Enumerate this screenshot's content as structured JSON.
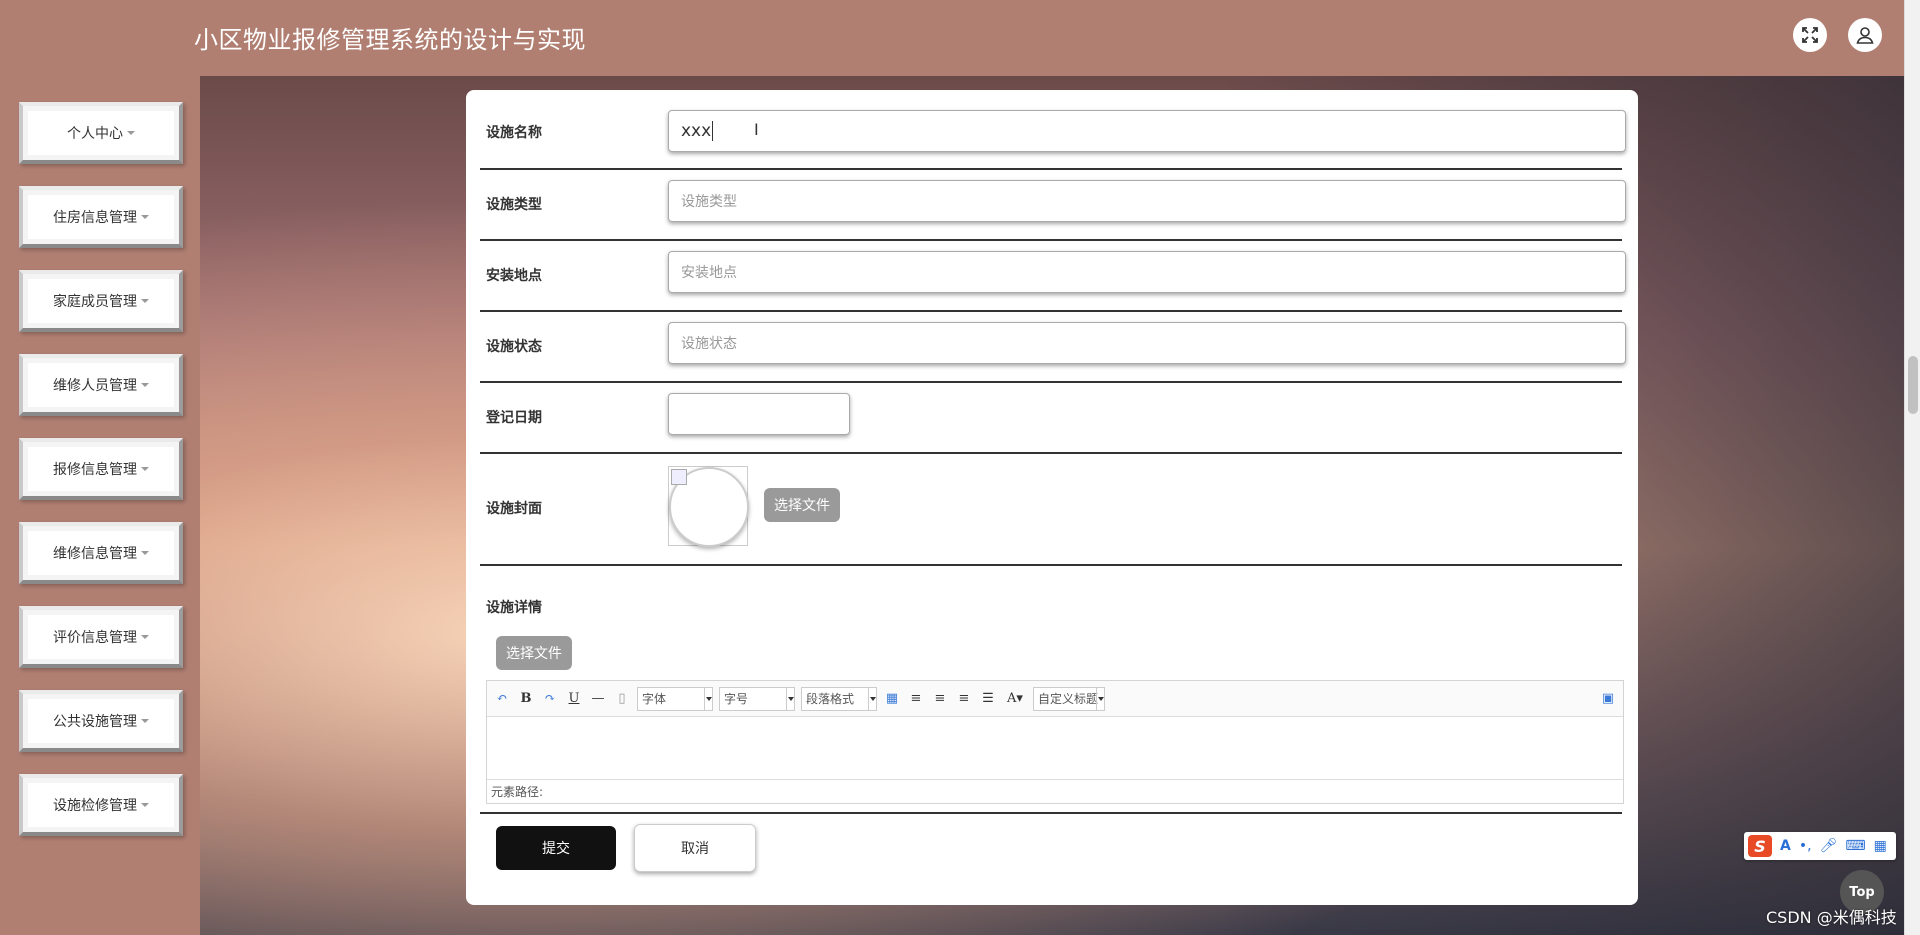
{
  "header": {
    "title": "小区物业报修管理系统的设计与实现"
  },
  "sidebar": {
    "items": [
      {
        "label": "个人中心"
      },
      {
        "label": "住房信息管理"
      },
      {
        "label": "家庭成员管理"
      },
      {
        "label": "维修人员管理"
      },
      {
        "label": "报修信息管理"
      },
      {
        "label": "维修信息管理"
      },
      {
        "label": "评价信息管理"
      },
      {
        "label": "公共设施管理"
      },
      {
        "label": "设施检修管理"
      }
    ]
  },
  "form": {
    "name": {
      "label": "设施名称",
      "value": "xxx"
    },
    "type": {
      "label": "设施类型",
      "placeholder": "设施类型"
    },
    "location": {
      "label": "安装地点",
      "placeholder": "安装地点"
    },
    "status": {
      "label": "设施状态",
      "placeholder": "设施状态"
    },
    "date": {
      "label": "登记日期",
      "value": ""
    },
    "cover": {
      "label": "设施封面",
      "button": "选择文件"
    },
    "details": {
      "label": "设施详情",
      "button": "选择文件"
    },
    "submit": "提交",
    "cancel": "取消"
  },
  "editor": {
    "font_family": "字体",
    "font_size": "字号",
    "paragraph": "段落格式",
    "custom_title": "自定义标题",
    "status_path": "元素路径:"
  },
  "ime": {
    "logo": "S"
  },
  "top_button": "Top",
  "watermark": "CSDN @米偶科技"
}
